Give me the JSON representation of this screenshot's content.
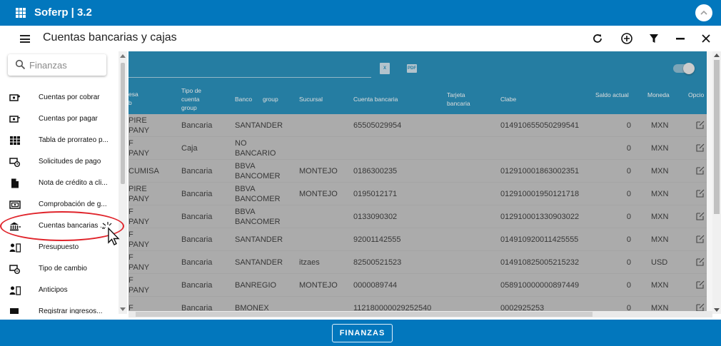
{
  "topbar": {
    "app_title": "Soferp | 3.2"
  },
  "header": {
    "title": "Cuentas bancarias y cajas"
  },
  "search": {
    "placeholder": "Finanzas"
  },
  "sidebar": {
    "items": [
      {
        "label": "Cuentas por cobrar",
        "icon": "money-in-icon"
      },
      {
        "label": "Cuentas por pagar",
        "icon": "money-out-icon"
      },
      {
        "label": "Tabla de prorrateo p...",
        "icon": "table-icon"
      },
      {
        "label": "Solicitudes de pago",
        "icon": "payment-request-icon"
      },
      {
        "label": "Nota de crédito a cli...",
        "icon": "document-icon"
      },
      {
        "label": "Comprobación de g...",
        "icon": "receipt-icon"
      },
      {
        "label": "Cuentas bancarias ...",
        "icon": "bank-icon"
      },
      {
        "label": "Presupuesto",
        "icon": "budget-icon"
      },
      {
        "label": "Tipo de cambio",
        "icon": "exchange-icon"
      },
      {
        "label": "Anticipos",
        "icon": "advance-icon"
      },
      {
        "label": "Registrar ingresos...",
        "icon": "register-income-icon"
      }
    ]
  },
  "table": {
    "headers": {
      "empresa": "esa\nb",
      "tipo": "Tipo de\ncuenta\ngroup",
      "banco": "Banco",
      "group": "group",
      "sucursal": "Sucursal",
      "cuenta": "Cuenta bancaria",
      "tarjeta": "Tarjeta\nbancaria",
      "clabe": "Clabe",
      "saldo": "Saldo actual",
      "moneda": "Moneda",
      "opciones": "Opcio"
    },
    "rows": [
      {
        "empresa": "PIRE\nPANY",
        "tipo": "Bancaria",
        "banco": "SANTANDER",
        "sucursal": "",
        "cuenta": "65505029954",
        "tarjeta": "",
        "clabe": "014910655050299541",
        "saldo": "0",
        "moneda": "MXN"
      },
      {
        "empresa": "F\nPANY",
        "tipo": "Caja",
        "banco": "NO\nBANCARIO",
        "sucursal": "",
        "cuenta": "",
        "tarjeta": "",
        "clabe": "",
        "saldo": "0",
        "moneda": "MXN"
      },
      {
        "empresa": "CUMISA",
        "tipo": "Bancaria",
        "banco": "BBVA\nBANCOMER",
        "sucursal": "MONTEJO",
        "cuenta": "0186300235",
        "tarjeta": "",
        "clabe": "012910001863002351",
        "saldo": "0",
        "moneda": "MXN"
      },
      {
        "empresa": "PIRE\nPANY",
        "tipo": "Bancaria",
        "banco": "BBVA\nBANCOMER",
        "sucursal": "MONTEJO",
        "cuenta": "0195012171",
        "tarjeta": "",
        "clabe": "012910001950121718",
        "saldo": "0",
        "moneda": "MXN"
      },
      {
        "empresa": "F\nPANY",
        "tipo": "Bancaria",
        "banco": "BBVA\nBANCOMER",
        "sucursal": "",
        "cuenta": "0133090302",
        "tarjeta": "",
        "clabe": "012910001330903022",
        "saldo": "0",
        "moneda": "MXN"
      },
      {
        "empresa": "F\nPANY",
        "tipo": "Bancaria",
        "banco": "SANTANDER",
        "sucursal": "",
        "cuenta": "92001142555",
        "tarjeta": "",
        "clabe": "014910920011425555",
        "saldo": "0",
        "moneda": "MXN"
      },
      {
        "empresa": "F\nPANY",
        "tipo": "Bancaria",
        "banco": "SANTANDER",
        "sucursal": "itzaes",
        "cuenta": "82500521523",
        "tarjeta": "",
        "clabe": "014910825005215232",
        "saldo": "0",
        "moneda": "USD"
      },
      {
        "empresa": "F\nPANY",
        "tipo": "Bancaria",
        "banco": "BANREGIO",
        "sucursal": "MONTEJO",
        "cuenta": "0000089744",
        "tarjeta": "",
        "clabe": "058910000000897449",
        "saldo": "0",
        "moneda": "MXN"
      },
      {
        "empresa": "F",
        "tipo": "Bancaria",
        "banco": "BMONEX",
        "sucursal": "",
        "cuenta": "112180000029252540",
        "tarjeta": "",
        "clabe": "0002925253",
        "saldo": "0",
        "moneda": "MXN"
      }
    ]
  },
  "footer": {
    "finanzas_label": "FINANZAS"
  },
  "colors": {
    "primary": "#0277bd",
    "table_header": "#0a7fb0",
    "annotation": "#e0242b"
  }
}
